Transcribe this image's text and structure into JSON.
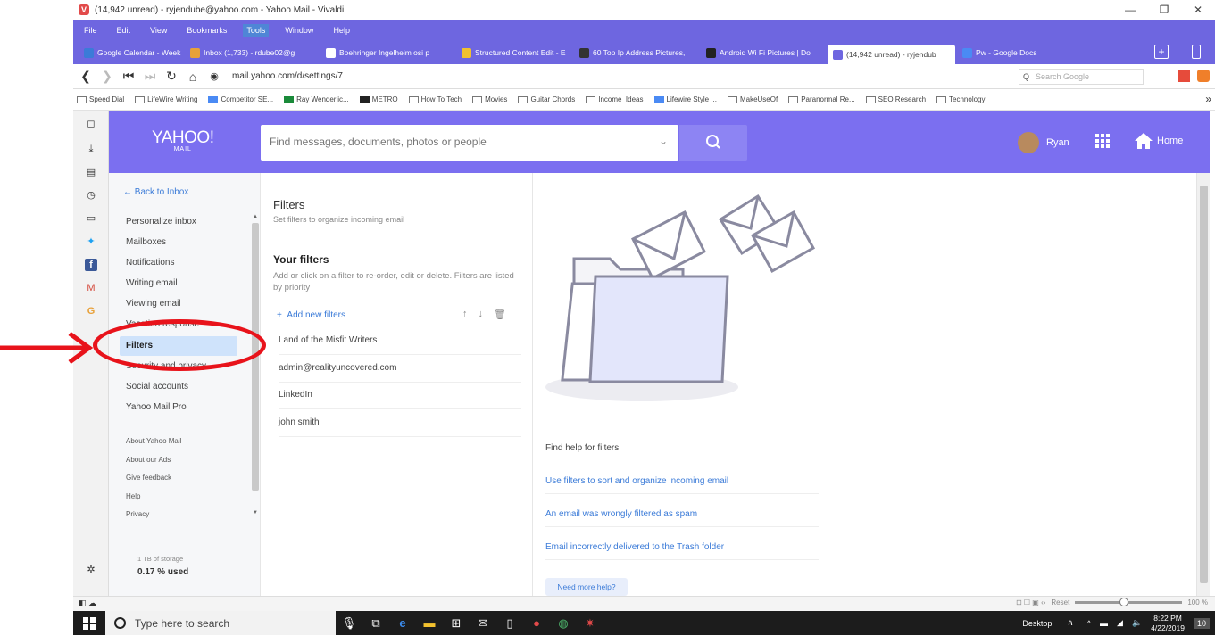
{
  "window": {
    "title": "(14,942 unread) - ryjendube@yahoo.com - Yahoo Mail - Vivaldi",
    "logo_letter": "V",
    "controls": [
      "—",
      "❐",
      "✕"
    ]
  },
  "menu": [
    "File",
    "Edit",
    "View",
    "Bookmarks",
    "Tools",
    "Window",
    "Help"
  ],
  "menu_active": "Tools",
  "tabs": [
    {
      "label": "Google Calendar - Week of",
      "color": "#3b7bd8"
    },
    {
      "label": "Inbox (1,733) - rdube02@g",
      "color": "#e8a13a"
    },
    {
      "label": "Boehringer Ingelheim osi p",
      "color": "#ffffff"
    },
    {
      "label": "Structured Content Edit - E",
      "color": "#f2c12e"
    },
    {
      "label": "60 Top Ip Address Pictures,",
      "color": "#333333"
    },
    {
      "label": "Android Wi Fi Pictures | Do",
      "color": "#222222"
    },
    {
      "label": "(14,942 unread) - ryjendub",
      "color": "#6e66e0"
    },
    {
      "label": "Pw - Google Docs",
      "color": "#4a8af4"
    }
  ],
  "address": {
    "url": "mail.yahoo.com/d/settings/7",
    "search_placeholder": "Search Google"
  },
  "bookmarks": [
    "Speed Dial",
    "LifeWire Writing",
    "Competitor SE...",
    "Ray Wenderlic...",
    "METRO",
    "How To Tech",
    "Movies",
    "Guitar Chords",
    "Income_Ideas",
    "Lifewire Style ...",
    "MakeUseOf",
    "Paranormal Re...",
    "SEO Research",
    "Technology"
  ],
  "yahoo": {
    "logo": "YAHOO!",
    "logo_sub": "MAIL",
    "search_placeholder": "Find messages, documents, photos or people",
    "user_name": "Ryan",
    "home_label": "Home"
  },
  "settings_nav": {
    "back": "Back to Inbox",
    "items": [
      "Personalize inbox",
      "Mailboxes",
      "Notifications",
      "Writing email",
      "Viewing email",
      "Vacation response",
      "Filters",
      "Security and privacy",
      "Social accounts",
      "Yahoo Mail Pro"
    ],
    "links": [
      "About Yahoo Mail",
      "About our Ads",
      "Give feedback",
      "Help",
      "Privacy"
    ],
    "storage": "1 TB of storage",
    "storage_used": "0.17 % used"
  },
  "filters": {
    "title": "Filters",
    "subtitle": "Set filters to organize incoming email",
    "your_filters": "Your filters",
    "description": "Add or click on a filter to re-order, edit or delete. Filters are listed by priority",
    "add_new": "Add new filters",
    "list": [
      "Land of the Misfit Writers",
      "admin@realityuncovered.com",
      "LinkedIn",
      "john smith"
    ]
  },
  "help": {
    "title": "Find help for filters",
    "links": [
      "Use filters to sort and organize incoming email",
      "An email was wrongly filtered as spam",
      "Email incorrectly delivered to the Trash folder"
    ],
    "need_more": "Need more help?"
  },
  "status": {
    "reset": "Reset",
    "zoom": "100 %"
  },
  "taskbar": {
    "search_placeholder": "Type here to search",
    "desktop": "Desktop",
    "time": "8:22 PM",
    "date": "4/22/2019",
    "notifications": "10"
  }
}
